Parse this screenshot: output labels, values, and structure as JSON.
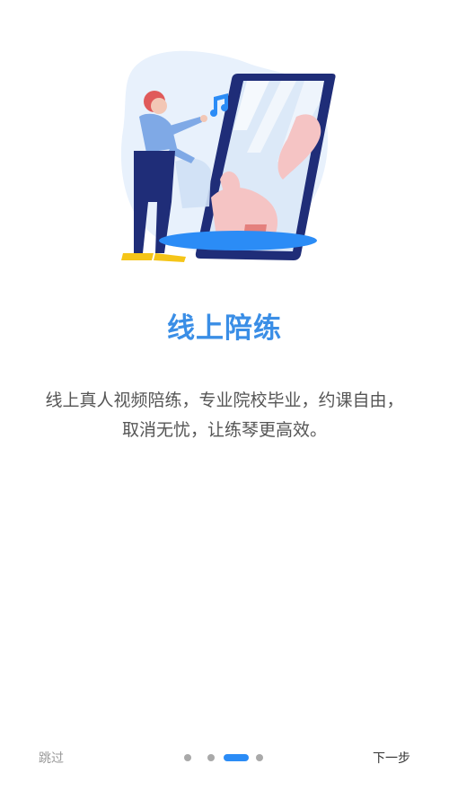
{
  "onboarding": {
    "title": "线上陪练",
    "description_lines": [
      "线上真人视频陪练，专业院校毕业，约课自由，",
      "取消无忧，让练琴更高效。"
    ]
  },
  "pager": {
    "total_pages": 4,
    "active_page": 3
  },
  "bottom_bar": {
    "skip_label": "跳过",
    "next_label": "下一步"
  },
  "colors": {
    "accent": "#2b8cf6",
    "title": "#3a8ee6",
    "phone": "#1f2d78",
    "dot_inactive": "#a9a9a9"
  },
  "icons": [
    "music-note-icon"
  ]
}
